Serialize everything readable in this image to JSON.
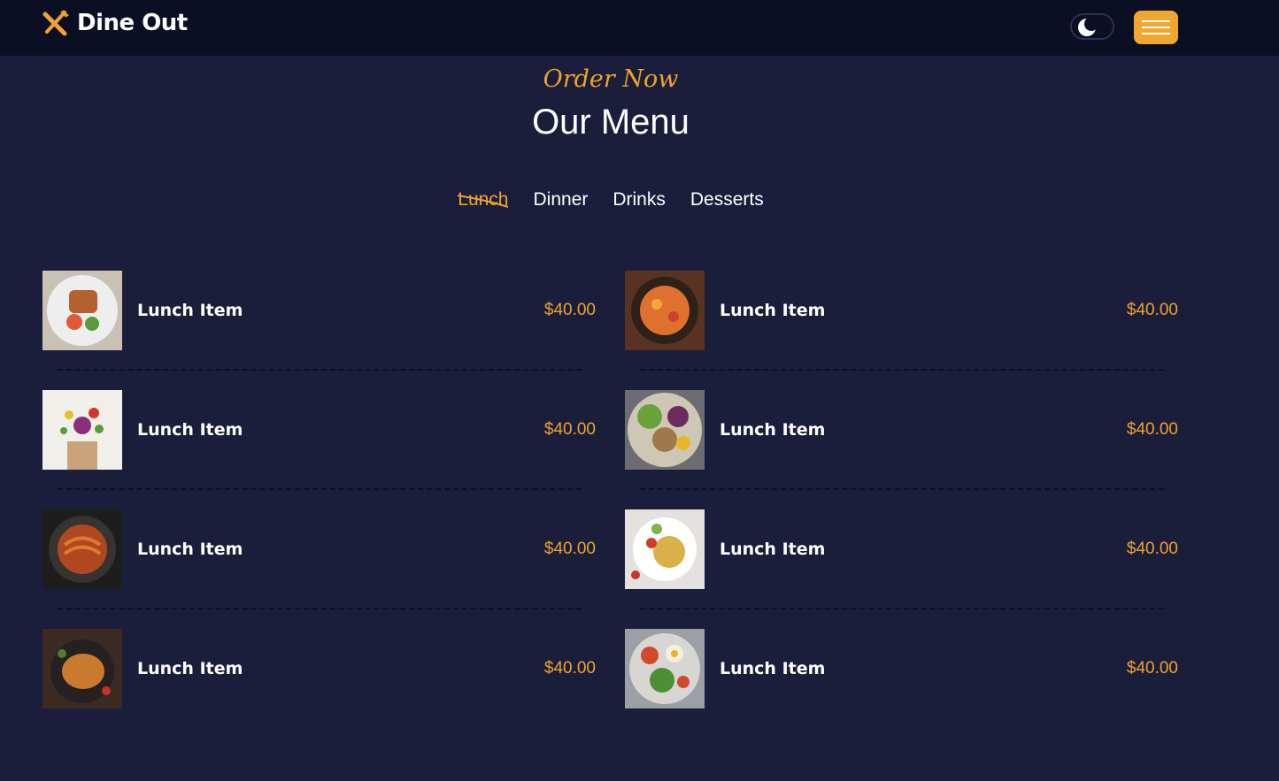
{
  "header": {
    "brand": "Dine Out",
    "logo_icon": "fork-knife-icon",
    "theme_toggle_icon": "moon-icon",
    "menu_icon": "hamburger-icon"
  },
  "colors": {
    "accent": "#f0a12e",
    "background": "#1b1e3b",
    "header_bg": "#0b0f24",
    "text": "#ffffff"
  },
  "section": {
    "eyebrow": "Order Now",
    "title": "Our Menu"
  },
  "tabs": [
    {
      "label": "Lunch",
      "active": true
    },
    {
      "label": "Dinner",
      "active": false
    },
    {
      "label": "Drinks",
      "active": false
    },
    {
      "label": "Desserts",
      "active": false
    }
  ],
  "menu_items": [
    {
      "name": "Lunch Item",
      "price": "$40.00",
      "image": "grilled-salmon-plate"
    },
    {
      "name": "Lunch Item",
      "price": "$40.00",
      "image": "penne-pasta-bowl"
    },
    {
      "name": "Lunch Item",
      "price": "$40.00",
      "image": "vegetables-bag"
    },
    {
      "name": "Lunch Item",
      "price": "$40.00",
      "image": "salad-bowl"
    },
    {
      "name": "Lunch Item",
      "price": "$40.00",
      "image": "noodles-pan"
    },
    {
      "name": "Lunch Item",
      "price": "$40.00",
      "image": "rice-plate"
    },
    {
      "name": "Lunch Item",
      "price": "$40.00",
      "image": "roast-chicken"
    },
    {
      "name": "Lunch Item",
      "price": "$40.00",
      "image": "egg-salad-plate"
    }
  ]
}
